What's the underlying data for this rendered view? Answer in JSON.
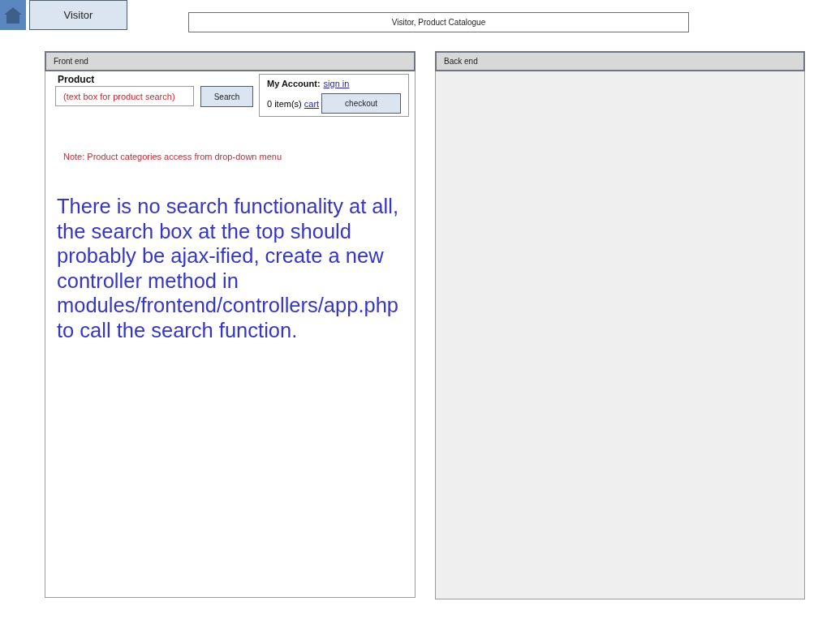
{
  "role_tab": {
    "label": "Visitor"
  },
  "page_title": "Visitor, Product Catalogue",
  "front_end": {
    "title": "Front end",
    "product_label": "Product",
    "search_field": {
      "placeholder": "(text box for product search)"
    },
    "search_button": "Search",
    "account": {
      "label": "My Account:",
      "sign_in_link": "sign in",
      "items_text": "0 item(s)",
      "cart_link": "cart",
      "checkout_button": "checkout"
    },
    "note": "Note: Product categories access from drop-down menu",
    "comment": "There is no search functionality at all, the search box at the top should probably be ajax-ified, create a new controller method in modules/frontend/controllers/app.php to call the search function."
  },
  "back_end": {
    "title": "Back end"
  }
}
